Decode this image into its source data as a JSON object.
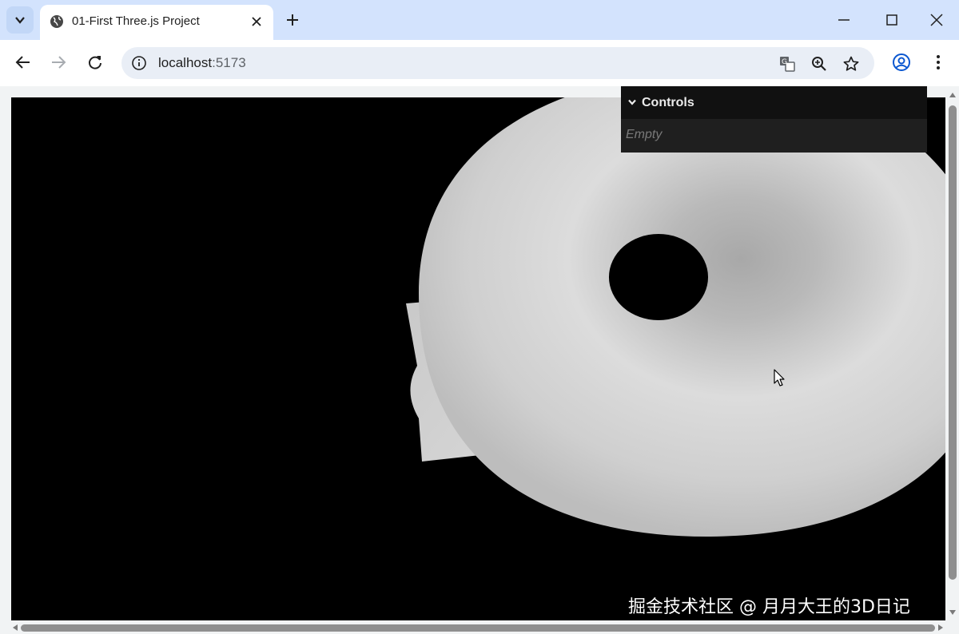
{
  "browser": {
    "tab": {
      "title": "01-First Three.js Project"
    },
    "address": {
      "host": "localhost",
      "port": ":5173"
    }
  },
  "gui": {
    "title": "Controls",
    "empty_text": "Empty"
  },
  "watermark": "掘金技术社区 @ 月月大王的3D日记",
  "icons": {
    "tab_search": "chevron-down-icon",
    "favicon": "globe-icon",
    "tab_close": "close-icon",
    "new_tab": "plus-icon",
    "back": "back-arrow-icon",
    "forward": "forward-arrow-icon",
    "reload": "reload-icon",
    "site_info": "info-icon",
    "translate": "translate-icon",
    "zoom": "zoom-icon",
    "bookmark": "star-icon",
    "profile": "profile-icon",
    "menu": "kebab-menu-icon"
  },
  "colors": {
    "tabbar": "#d3e3fd",
    "viewport": "#000000",
    "gui_bg": "#1f1f1f"
  }
}
